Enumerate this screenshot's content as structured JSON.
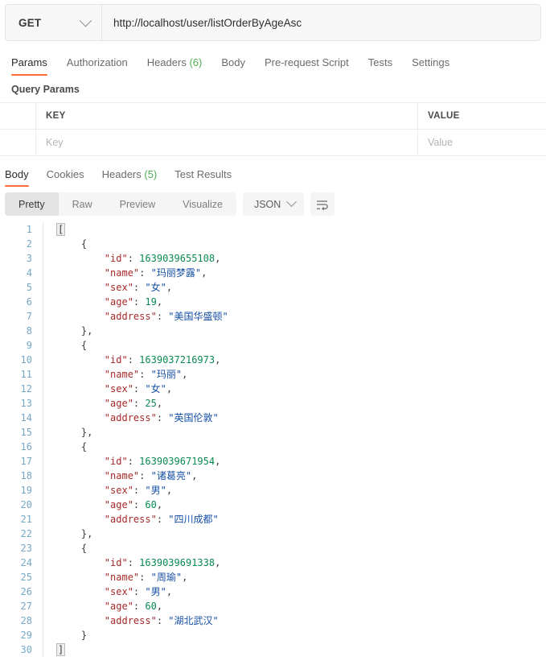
{
  "request": {
    "method": "GET",
    "url": "http://localhost/user/listOrderByAgeAsc",
    "tabs": [
      {
        "label": "Params",
        "active": true
      },
      {
        "label": "Authorization",
        "active": false
      },
      {
        "label": "Headers",
        "count": "(6)",
        "active": false
      },
      {
        "label": "Body",
        "active": false
      },
      {
        "label": "Pre-request Script",
        "active": false
      },
      {
        "label": "Tests",
        "active": false
      },
      {
        "label": "Settings",
        "active": false
      }
    ],
    "query_params": {
      "title": "Query Params",
      "columns": [
        "KEY",
        "VALUE"
      ],
      "empty_row": {
        "key_placeholder": "Key",
        "value_placeholder": "Value"
      }
    }
  },
  "response": {
    "tabs": [
      {
        "label": "Body",
        "active": true
      },
      {
        "label": "Cookies",
        "active": false
      },
      {
        "label": "Headers",
        "count": "(5)",
        "active": false
      },
      {
        "label": "Test Results",
        "active": false
      }
    ],
    "view_modes": [
      {
        "label": "Pretty",
        "active": true
      },
      {
        "label": "Raw",
        "active": false
      },
      {
        "label": "Preview",
        "active": false
      },
      {
        "label": "Visualize",
        "active": false
      }
    ],
    "format": "JSON",
    "wrap_icon": "word-wrap-icon"
  },
  "body": {
    "records": [
      {
        "id": "1639039655108",
        "name": "玛丽梦露",
        "sex": "女",
        "age": "19",
        "address": "美国华盛顿"
      },
      {
        "id": "1639037216973",
        "name": "玛丽",
        "sex": "女",
        "age": "25",
        "address": "英国伦敦"
      },
      {
        "id": "1639039671954",
        "name": "诸葛亮",
        "sex": "男",
        "age": "60",
        "address": "四川成都"
      },
      {
        "id": "1639039691338",
        "name": "周瑜",
        "sex": "男",
        "age": "60",
        "address": "湖北武汉"
      }
    ],
    "total_lines": 30
  },
  "colors": {
    "accent": "#ff6c37",
    "key": "#a52a2a",
    "string": "#1750a5",
    "number": "#0b8a52",
    "count": "#4caf50"
  }
}
